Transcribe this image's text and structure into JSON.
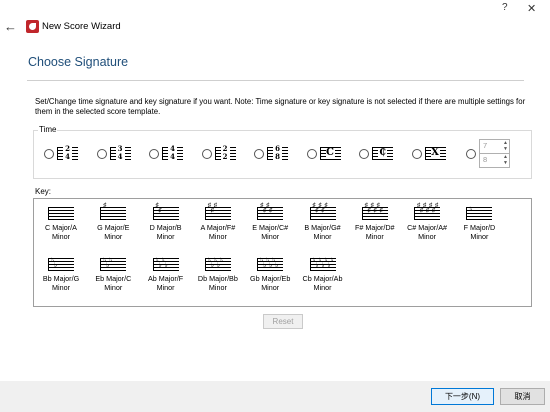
{
  "window": {
    "title": "New Score Wizard",
    "help_glyph": "?",
    "close_glyph": "✕",
    "back_glyph": "←"
  },
  "page": {
    "title": "Choose Signature",
    "description": "Set/Change time signature and key signature if you want. Note: Time signature or key signature is not selected if there are multiple settings for them in the selected score template."
  },
  "time_group": {
    "label": "Time",
    "options": [
      {
        "top": "2",
        "bottom": "4"
      },
      {
        "top": "3",
        "bottom": "4"
      },
      {
        "top": "4",
        "bottom": "4"
      },
      {
        "top": "2",
        "bottom": "2"
      },
      {
        "top": "6",
        "bottom": "8"
      },
      {
        "symbol": "C",
        "name": "common-time"
      },
      {
        "symbol": "₵",
        "name": "cut-time"
      },
      {
        "symbol": "X",
        "name": "no-time"
      }
    ],
    "custom": {
      "top": "7",
      "bottom": "8"
    }
  },
  "key_group": {
    "label": "Key:",
    "rows": [
      [
        {
          "line1": "C Major/A",
          "line2": "Minor",
          "sharps": 0,
          "flats": 0
        },
        {
          "line1": "G Major/E",
          "line2": "Minor",
          "sharps": 1,
          "flats": 0
        },
        {
          "line1": "D Major/B",
          "line2": "Minor",
          "sharps": 2,
          "flats": 0
        },
        {
          "line1": "A Major/F#",
          "line2": "Minor",
          "sharps": 3,
          "flats": 0
        },
        {
          "line1": "E Major/C#",
          "line2": "Minor",
          "sharps": 4,
          "flats": 0
        },
        {
          "line1": "B Major/G#",
          "line2": "Minor",
          "sharps": 5,
          "flats": 0
        },
        {
          "line1": "F# Major/D#",
          "line2": "Minor",
          "sharps": 6,
          "flats": 0
        },
        {
          "line1": "C# Major/A#",
          "line2": "Minor",
          "sharps": 7,
          "flats": 0
        },
        {
          "line1": "F Major/D",
          "line2": "Minor",
          "sharps": 0,
          "flats": 1
        }
      ],
      [
        {
          "line1": "Bb Major/G",
          "line2": "Minor",
          "sharps": 0,
          "flats": 2
        },
        {
          "line1": "Eb Major/C",
          "line2": "Minor",
          "sharps": 0,
          "flats": 3
        },
        {
          "line1": "Ab Major/F",
          "line2": "Minor",
          "sharps": 0,
          "flats": 4
        },
        {
          "line1": "Db Major/Bb",
          "line2": "Minor",
          "sharps": 0,
          "flats": 5
        },
        {
          "line1": "Gb Major/Eb",
          "line2": "Minor",
          "sharps": 0,
          "flats": 6
        },
        {
          "line1": "Cb Major/Ab",
          "line2": "Minor",
          "sharps": 0,
          "flats": 7
        }
      ]
    ]
  },
  "buttons": {
    "reset": "Reset",
    "next": "下一步(N)",
    "cancel": "取消"
  },
  "colors": {
    "heading": "#1f4e79",
    "accent": "#0078d7",
    "footer_bg": "#f0f0f0"
  }
}
